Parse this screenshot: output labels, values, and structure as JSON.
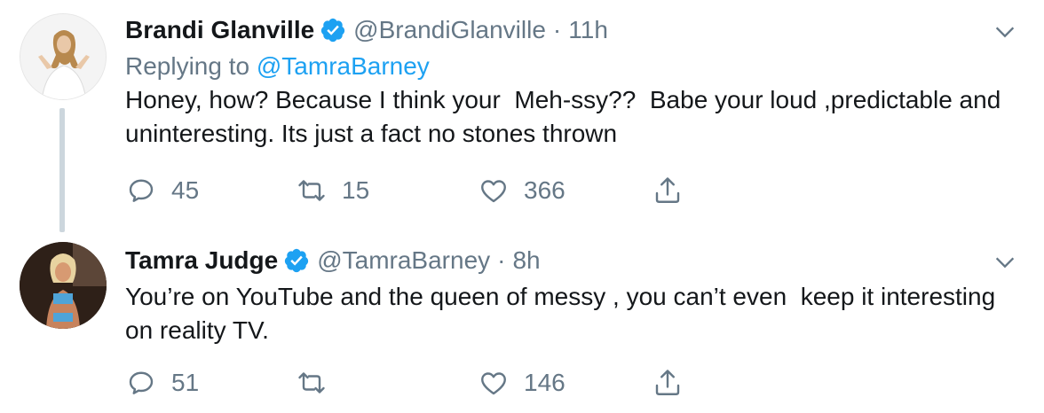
{
  "tweets": [
    {
      "display_name": "Brandi Glanville",
      "handle": "@BrandiGlanville",
      "separator": "·",
      "time": "11h",
      "replying_to_prefix": "Replying to ",
      "replying_to_handle": "@TamraBarney",
      "text": "Honey, how? Because I think your  Meh-ssy??  Babe your loud ,predictable and uninteresting. Its just a fact no stones thrown",
      "reply_count": "45",
      "retweet_count": "15",
      "like_count": "366"
    },
    {
      "display_name": "Tamra Judge",
      "handle": "@TamraBarney",
      "separator": "·",
      "time": "8h",
      "text": "You’re on YouTube and the queen of messy , you can’t even  keep it interesting on reality TV.",
      "reply_count": "51",
      "retweet_count": "",
      "like_count": "146"
    }
  ],
  "icons": {
    "verified": "verified-badge-icon",
    "caret": "chevron-down-icon",
    "reply": "reply-icon",
    "retweet": "retweet-icon",
    "like": "heart-icon",
    "share": "share-icon"
  },
  "colors": {
    "text": "#14171a",
    "secondary": "#657786",
    "link": "#1da1f2",
    "thread_line": "#ccd6dd"
  }
}
